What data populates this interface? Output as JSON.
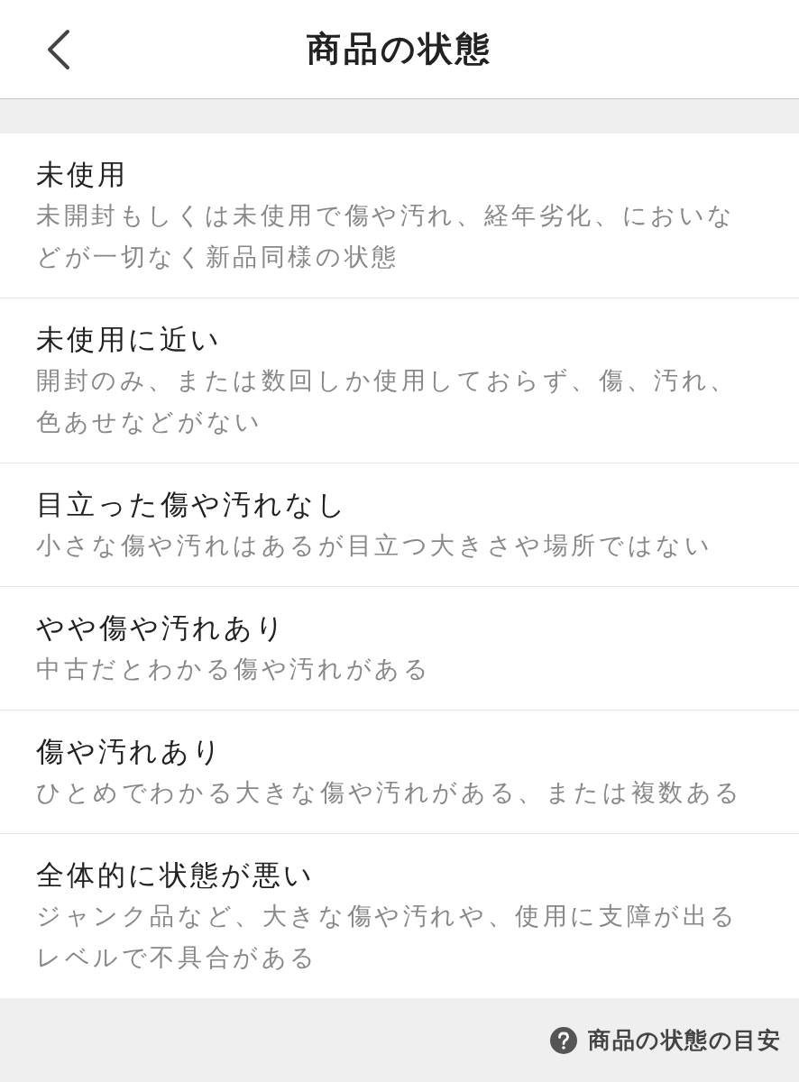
{
  "header": {
    "title": "商品の状態"
  },
  "conditions": [
    {
      "title": "未使用",
      "description": "未開封もしくは未使用で傷や汚れ、経年劣化、においなどが一切なく新品同様の状態"
    },
    {
      "title": "未使用に近い",
      "description": "開封のみ、または数回しか使用しておらず、傷、汚れ、色あせなどがない"
    },
    {
      "title": "目立った傷や汚れなし",
      "description": "小さな傷や汚れはあるが目立つ大きさや場所ではない"
    },
    {
      "title": "やや傷や汚れあり",
      "description": "中古だとわかる傷や汚れがある"
    },
    {
      "title": "傷や汚れあり",
      "description": "ひとめでわかる大きな傷や汚れがある、または複数ある"
    },
    {
      "title": "全体的に状態が悪い",
      "description": "ジャンク品など、大きな傷や汚れや、使用に支障が出るレベルで不具合がある"
    }
  ],
  "footer": {
    "help_link": "商品の状態の目安"
  }
}
